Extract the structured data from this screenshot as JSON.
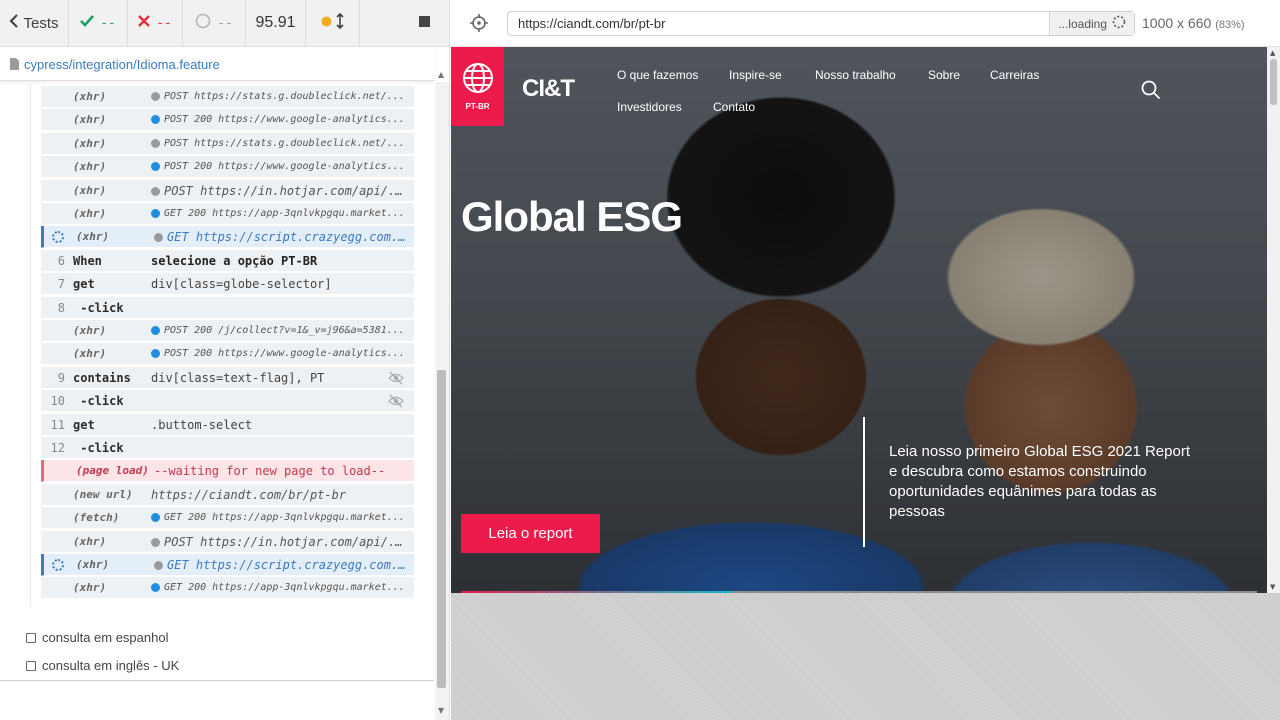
{
  "reporter": {
    "back_label": "Tests",
    "passed": "--",
    "failed": "--",
    "pending": "--",
    "duration": "95.91",
    "spec_path": "cypress/integration/Idioma.feature",
    "commands": [
      {
        "num": "",
        "kind": "(xhr)",
        "dot": "#9a9a9a",
        "msg": "POST https://stats.g.doubleclick.net/...",
        "style": "small"
      },
      {
        "num": "",
        "kind": "(xhr)",
        "dot": "#1f8ee0",
        "msg": "POST 200 https://www.google-analytics...",
        "style": "small"
      },
      {
        "num": "",
        "kind": "(xhr)",
        "dot": "#9a9a9a",
        "msg": "POST https://stats.g.doubleclick.net/...",
        "style": "small"
      },
      {
        "num": "",
        "kind": "(xhr)",
        "dot": "#1f8ee0",
        "msg": "POST 200 https://www.google-analytics...",
        "style": "small"
      },
      {
        "num": "",
        "kind": "(xhr)",
        "dot": "#9a9a9a",
        "msg": "POST https://in.hotjar.com/api/...",
        "style": "url"
      },
      {
        "num": "",
        "kind": "(xhr)",
        "dot": "#1f8ee0",
        "msg": "GET 200 https://app-3qnlvkpgqu.market...",
        "style": "small"
      },
      {
        "num": "",
        "kind": "(xhr)",
        "dot": "#9a9a9a",
        "msg": "GET https://script.crazyegg.com...",
        "style": "url",
        "active": true
      },
      {
        "num": "6",
        "kind": "When",
        "dot": "",
        "msg": "selecione a opção PT-BR",
        "style": "bold"
      },
      {
        "num": "7",
        "kind": "get",
        "dot": "",
        "msg": "div[class=globe-selector]",
        "style": ""
      },
      {
        "num": "8",
        "kind": " -click",
        "dot": "",
        "msg": "",
        "style": ""
      },
      {
        "num": "",
        "kind": "(xhr)",
        "dot": "#1f8ee0",
        "msg": "POST 200 /j/collect?v=1&_v=j96&a=5381...",
        "style": "small"
      },
      {
        "num": "",
        "kind": "(xhr)",
        "dot": "#1f8ee0",
        "msg": "POST 200 https://www.google-analytics...",
        "style": "small"
      },
      {
        "num": "9",
        "kind": "contains",
        "dot": "",
        "msg": "div[class=text-flag], PT",
        "style": "",
        "eye": true
      },
      {
        "num": "10",
        "kind": " -click",
        "dot": "",
        "msg": "",
        "style": "",
        "eye": true
      },
      {
        "num": "11",
        "kind": "get",
        "dot": "",
        "msg": ".buttom-select",
        "style": ""
      },
      {
        "num": "12",
        "kind": " -click",
        "dot": "",
        "msg": "",
        "style": ""
      },
      {
        "num": "",
        "kind": "(page load)",
        "dot": "",
        "msg": "--waiting for new page to load--",
        "style": "",
        "pageload": true
      },
      {
        "num": "",
        "kind": "(new url)",
        "dot": "",
        "msg": "https://ciandt.com/br/pt-br",
        "style": "url"
      },
      {
        "num": "",
        "kind": "(fetch)",
        "dot": "#1f8ee0",
        "msg": "GET 200 https://app-3qnlvkpgqu.market...",
        "style": "small"
      },
      {
        "num": "",
        "kind": "(xhr)",
        "dot": "#9a9a9a",
        "msg": "POST https://in.hotjar.com/api/...",
        "style": "url"
      },
      {
        "num": "",
        "kind": "(xhr)",
        "dot": "#9a9a9a",
        "msg": "GET https://script.crazyegg.com...",
        "style": "url",
        "active": true
      },
      {
        "num": "",
        "kind": "(xhr)",
        "dot": "#1f8ee0",
        "msg": "GET 200 https://app-3qnlvkpgqu.market...",
        "style": "small"
      }
    ],
    "tests": [
      {
        "label": "consulta em espanhol"
      },
      {
        "label": "consulta em inglês - UK"
      }
    ]
  },
  "aut": {
    "url": "https://ciandt.com/br/pt-br",
    "loading_label": "...loading",
    "viewport": "1000 x 660",
    "scale": "(83%)"
  },
  "site": {
    "lang_label": "PT-BR",
    "logo_text": "CI&T",
    "nav": [
      "O que fazemos",
      "Inspire-se",
      "Nosso trabalho",
      "Sobre",
      "Carreiras",
      "Investidores",
      "Contato"
    ],
    "hero_title": "Global ESG",
    "hero_text": "Leia nosso primeiro Global ESG 2021 Report e descubra como estamos construindo oportunidades equânimes para todas as pessoas",
    "cta_label": "Leia o report",
    "carousel_progress": 0.34
  },
  "colors": {
    "brand": "#ec1b4b",
    "pass": "#1e9c62",
    "fail": "#e0303c",
    "link": "#3b7bbf"
  }
}
